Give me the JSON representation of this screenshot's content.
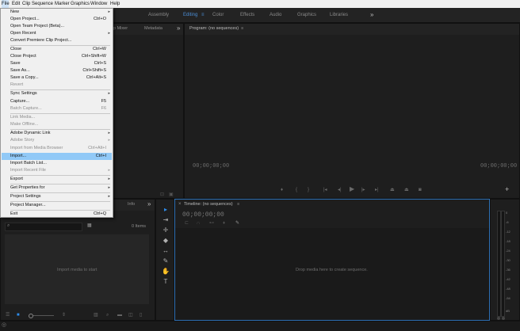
{
  "menubar": {
    "items": [
      "File",
      "Edit",
      "Clip",
      "Sequence",
      "Marker",
      "Graphics",
      "Window",
      "Help"
    ]
  },
  "workspaces": {
    "tabs": [
      "Assembly",
      "Editing",
      "Color",
      "Effects",
      "Audio",
      "Graphics",
      "Libraries"
    ],
    "more": "»"
  },
  "file_menu": {
    "items": [
      {
        "label": "New",
        "shortcut": "",
        "submenu": true,
        "disabled": false
      },
      {
        "label": "Open Project...",
        "shortcut": "Ctrl+O",
        "submenu": false,
        "disabled": false
      },
      {
        "label": "Open Team Project (Beta)...",
        "shortcut": "",
        "submenu": false,
        "disabled": false
      },
      {
        "label": "Open Recent",
        "shortcut": "",
        "submenu": true,
        "disabled": false
      },
      {
        "label": "Convert Premiere Clip Project...",
        "shortcut": "",
        "submenu": false,
        "disabled": false
      },
      {
        "label": "Close",
        "shortcut": "Ctrl+W",
        "submenu": false,
        "disabled": false
      },
      {
        "label": "Close Project",
        "shortcut": "Ctrl+Shift+W",
        "submenu": false,
        "disabled": false
      },
      {
        "label": "Save",
        "shortcut": "Ctrl+S",
        "submenu": false,
        "disabled": false
      },
      {
        "label": "Save As...",
        "shortcut": "Ctrl+Shift+S",
        "submenu": false,
        "disabled": false
      },
      {
        "label": "Save a Copy...",
        "shortcut": "Ctrl+Alt+S",
        "submenu": false,
        "disabled": false
      },
      {
        "label": "Revert",
        "shortcut": "",
        "submenu": false,
        "disabled": true
      },
      {
        "label": "Sync Settings",
        "shortcut": "",
        "submenu": true,
        "disabled": false
      },
      {
        "label": "Capture...",
        "shortcut": "F5",
        "submenu": false,
        "disabled": false
      },
      {
        "label": "Batch Capture...",
        "shortcut": "F6",
        "submenu": false,
        "disabled": true
      },
      {
        "label": "Link Media...",
        "shortcut": "",
        "submenu": false,
        "disabled": true
      },
      {
        "label": "Make Offline...",
        "shortcut": "",
        "submenu": false,
        "disabled": true
      },
      {
        "label": "Adobe Dynamic Link",
        "shortcut": "",
        "submenu": true,
        "disabled": false
      },
      {
        "label": "Adobe Story",
        "shortcut": "",
        "submenu": true,
        "disabled": true
      },
      {
        "label": "Import from Media Browser",
        "shortcut": "Ctrl+Alt+I",
        "submenu": false,
        "disabled": true
      },
      {
        "label": "Import...",
        "shortcut": "Ctrl+I",
        "submenu": false,
        "disabled": false,
        "highlight": true
      },
      {
        "label": "Import Batch List...",
        "shortcut": "",
        "submenu": false,
        "disabled": false
      },
      {
        "label": "Import Recent File",
        "shortcut": "",
        "submenu": true,
        "disabled": true
      },
      {
        "label": "Export",
        "shortcut": "",
        "submenu": true,
        "disabled": false
      },
      {
        "label": "Get Properties for",
        "shortcut": "",
        "submenu": true,
        "disabled": false
      },
      {
        "label": "Project Settings",
        "shortcut": "",
        "submenu": true,
        "disabled": false
      },
      {
        "label": "Project Manager...",
        "shortcut": "",
        "submenu": false,
        "disabled": false
      },
      {
        "label": "Exit",
        "shortcut": "Ctrl+Q",
        "submenu": false,
        "disabled": false
      }
    ]
  },
  "source_panel": {
    "tab_fragment": "p Mixer",
    "metadata_tab": "Metadata",
    "more": "»"
  },
  "program_monitor": {
    "title": "Program: (no sequences)",
    "menu_glyph": "≡",
    "timecode_left": "00;00;00;00",
    "timecode_right": "00;00;00;00"
  },
  "project_panel": {
    "info_tab": "Info",
    "more": "»",
    "item_count": "0 Items",
    "empty_message": "Import media to start"
  },
  "timeline": {
    "title": "Timeline: (no sequences)",
    "menu_glyph": "≡",
    "timecode": "00;00;00;00",
    "empty_message": "Drop media here to create sequence."
  },
  "audio_meter": {
    "ticks": [
      "0",
      "-6",
      "-12",
      "-18",
      "-24",
      "-30",
      "-36",
      "-42",
      "-48",
      "-54",
      "dB"
    ]
  },
  "colors": {
    "accent": "#2d8ceb",
    "menu_highlight": "#91c9f7",
    "menubar_bg": "#f0f0f0",
    "panel_bg": "#1e1e1e"
  }
}
